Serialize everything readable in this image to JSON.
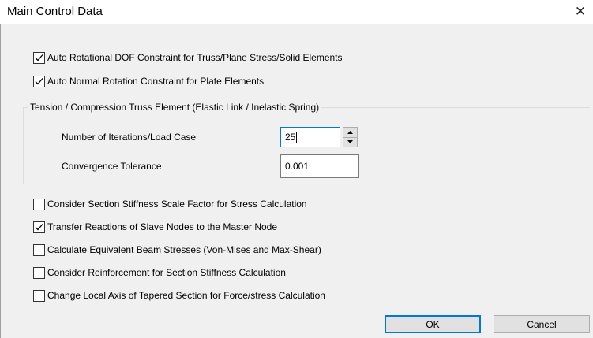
{
  "window": {
    "title": "Main Control Data",
    "close_glyph": "✕"
  },
  "options_top": [
    {
      "label": "Auto Rotational DOF Constraint for Truss/Plane Stress/Solid Elements",
      "checked": true
    },
    {
      "label": "Auto Normal Rotation Constraint for Plate Elements",
      "checked": true
    }
  ],
  "truss_group": {
    "title": "Tension / Compression Truss Element (Elastic Link / Inelastic Spring)",
    "iterations_label": "Number of Iterations/Load Case",
    "iterations_value": "25",
    "tolerance_label": "Convergence Tolerance",
    "tolerance_value": "0.001"
  },
  "options_bottom": [
    {
      "label": "Consider Section Stiffness Scale Factor for Stress Calculation",
      "checked": false
    },
    {
      "label": "Transfer Reactions of Slave Nodes to the Master Node",
      "checked": true
    },
    {
      "label": "Calculate Equivalent Beam Stresses (Von-Mises and Max-Shear)",
      "checked": false
    },
    {
      "label": "Consider Reinforcement for Section Stiffness Calculation",
      "checked": false
    },
    {
      "label": "Change Local Axis of Tapered Section for Force/stress Calculation",
      "checked": false
    }
  ],
  "buttons": {
    "ok": "OK",
    "cancel": "Cancel"
  },
  "colors": {
    "focus_accent": "#0078d7",
    "dialog_bg": "#f0f0f0"
  }
}
